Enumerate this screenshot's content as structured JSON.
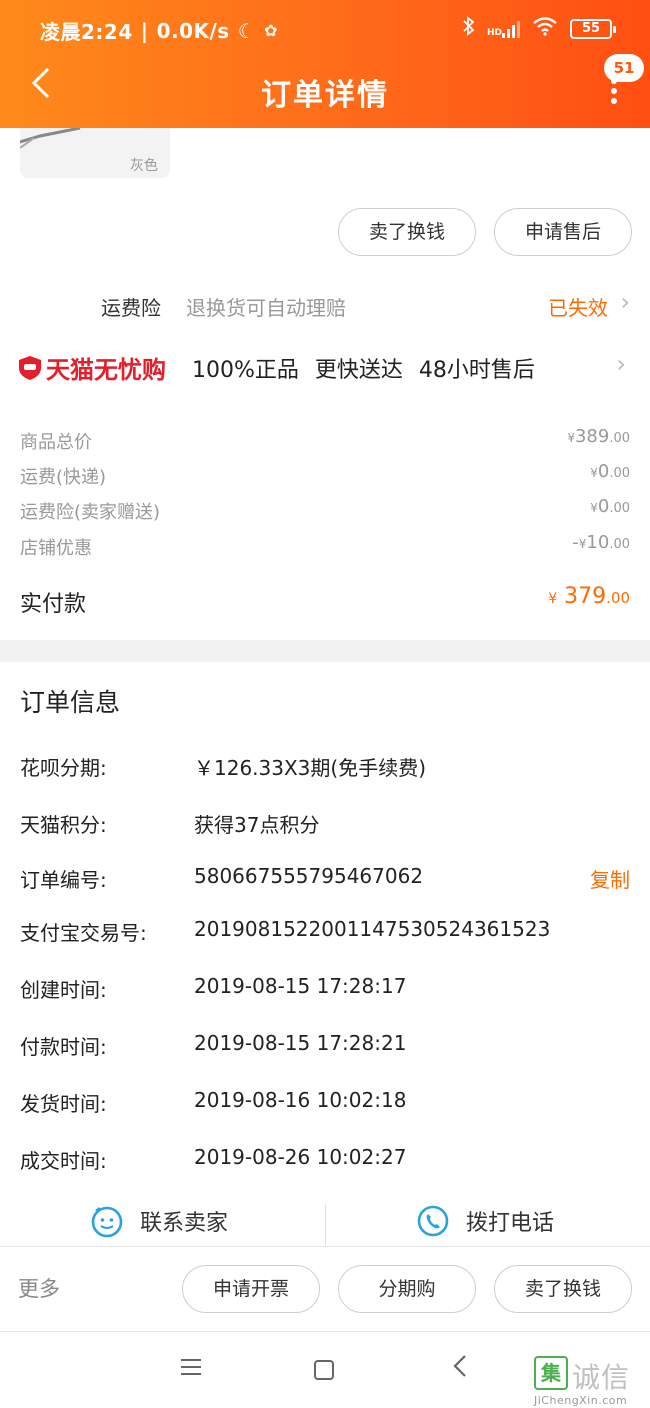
{
  "status_bar": {
    "time": "凌晨2:24",
    "net_speed": "0.0K/s",
    "battery": "55",
    "hd": "HD"
  },
  "nav": {
    "title": "订单详情",
    "badge": "51"
  },
  "product": {
    "color": "灰色"
  },
  "item_actions": {
    "sell_btn": "卖了换钱",
    "aftersale_btn": "申请售后"
  },
  "insurance": {
    "label": "运费险",
    "desc": "退换货可自动理赔",
    "status": "已失效"
  },
  "tmall": {
    "brand": "天猫无忧购",
    "features": [
      "100%正品",
      "更快送达",
      "48小时售后"
    ]
  },
  "prices": [
    {
      "label": "商品总价",
      "prefix": "",
      "int": "389",
      "dec": ".00"
    },
    {
      "label": "运费(快递)",
      "prefix": "",
      "int": "0",
      "dec": ".00"
    },
    {
      "label": "运费险(卖家赠送)",
      "prefix": "",
      "int": "0",
      "dec": ".00"
    },
    {
      "label": "店铺优惠",
      "prefix": "-",
      "int": "10",
      "dec": ".00"
    }
  ],
  "currency": "¥",
  "paid": {
    "label": "实付款",
    "int": "379",
    "dec": ".00"
  },
  "order_info": {
    "title": "订单信息",
    "rows": [
      {
        "k": "花呗分期:",
        "v": "￥126.33X3期(免手续费)"
      },
      {
        "k": "天猫积分:",
        "v": "获得37点积分"
      },
      {
        "k": "订单编号:",
        "v": "580667555795467062"
      },
      {
        "k": "支付宝交易号:",
        "v": "2019081522001147530524361523"
      },
      {
        "k": "创建时间:",
        "v": "2019-08-15 17:28:17"
      },
      {
        "k": "付款时间:",
        "v": "2019-08-15 17:28:21"
      },
      {
        "k": "发货时间:",
        "v": "2019-08-16 10:02:18"
      },
      {
        "k": "成交时间:",
        "v": "2019-08-26 10:02:27"
      }
    ],
    "copy": "复制"
  },
  "contact": {
    "seller": "联系卖家",
    "phone": "拨打电话"
  },
  "bottom": {
    "more": "更多",
    "invoice": "申请开票",
    "installment": "分期购",
    "sell": "卖了换钱"
  },
  "watermark": {
    "char": "集",
    "text": "诚信",
    "url": "JiChengXin.com"
  },
  "colors": {
    "accent": "#ff6a00",
    "header_start": "#ff8a1a",
    "header_end": "#ff4f12",
    "tmall_red": "#e41f2b"
  }
}
